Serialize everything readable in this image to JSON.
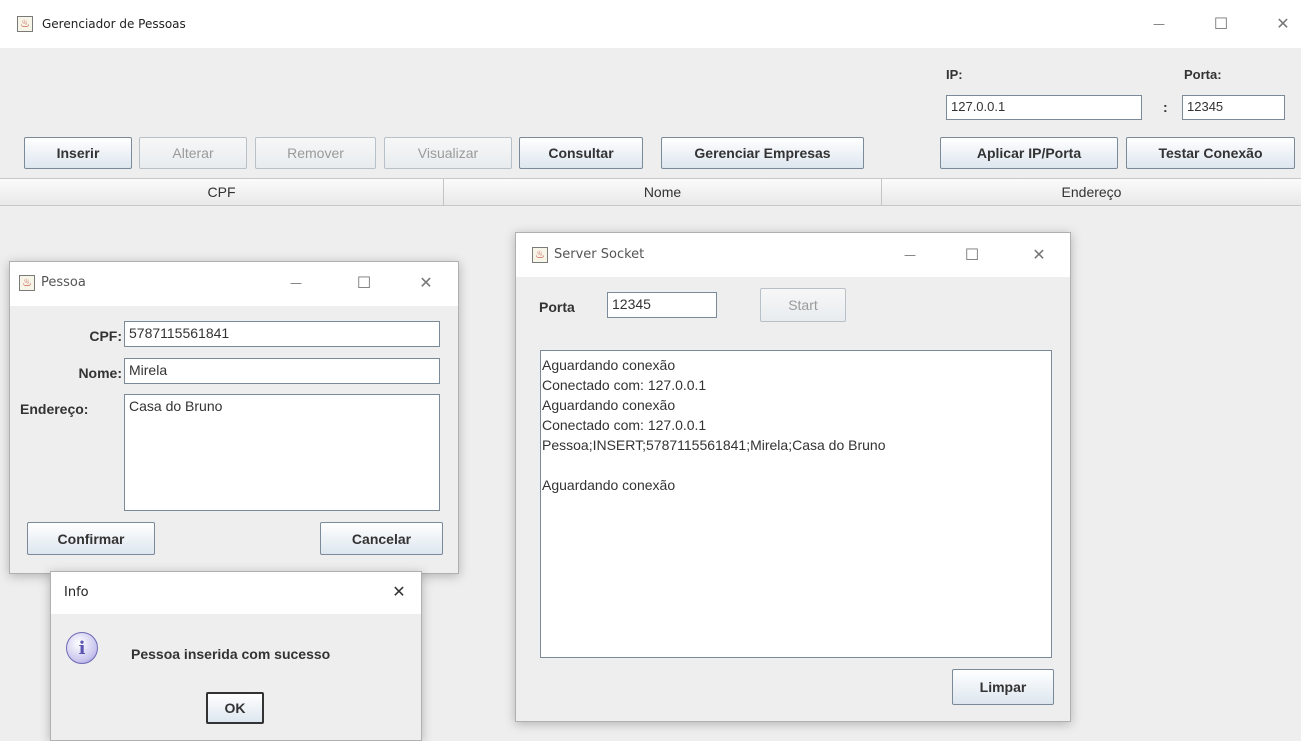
{
  "main_window": {
    "title": "Gerenciador de Pessoas",
    "ip_label": "IP:",
    "ip_value": "127.0.0.1",
    "port_label": "Porta:",
    "port_value": "12345",
    "colon": ":",
    "buttons": {
      "inserir": "Inserir",
      "alterar": "Alterar",
      "remover": "Remover",
      "visualizar": "Visualizar",
      "consultar": "Consultar",
      "gerenciar_empresas": "Gerenciar Empresas",
      "aplicar": "Aplicar IP/Porta",
      "testar": "Testar Conexão"
    },
    "table_headers": [
      "CPF",
      "Nome",
      "Endereço"
    ]
  },
  "pessoa_dialog": {
    "title": "Pessoa",
    "cpf_label": "CPF:",
    "cpf_value": "5787115561841",
    "nome_label": "Nome:",
    "nome_value": "Mirela",
    "endereco_label": "Endereço:",
    "endereco_value": "Casa do Bruno",
    "confirm_label": "Confirmar",
    "cancel_label": "Cancelar"
  },
  "server_window": {
    "title": "Server Socket",
    "port_label": "Porta",
    "port_value": "12345",
    "start_label": "Start",
    "log_lines": [
      "Aguardando conexão",
      "Conectado com: 127.0.0.1",
      "Aguardando conexão",
      "Conectado com: 127.0.0.1",
      "Pessoa;INSERT;5787115561841;Mirela;Casa do Bruno",
      "",
      "Aguardando conexão"
    ],
    "clear_label": "Limpar"
  },
  "info_dialog": {
    "title": "Info",
    "message": "Pessoa inserida com sucesso",
    "ok_label": "OK",
    "icon": "info-icon"
  },
  "window_controls": {
    "minimize": "—",
    "maximize": "☐",
    "close": "✕"
  }
}
